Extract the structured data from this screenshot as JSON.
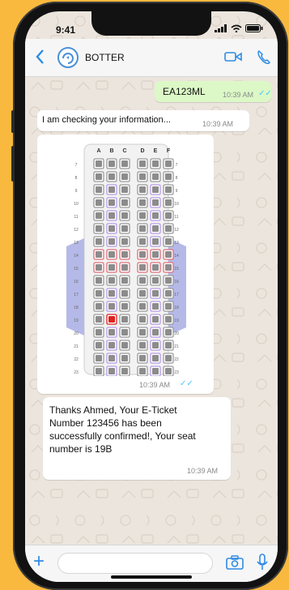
{
  "status": {
    "time": "9:41"
  },
  "header": {
    "contact_name": "BOTTER"
  },
  "messages": {
    "m1": {
      "text": "EA123ML",
      "time": "10:39 AM"
    },
    "m2": {
      "text": "I am checking your information...",
      "time": "10:39 AM"
    },
    "m3": {
      "time": "10:39 AM"
    },
    "m4": {
      "text": "Thanks Ahmed, Your E-Ticket Number 123456 has been successfully confirmed!, Your seat number is 19B",
      "time": "10:39 AM"
    }
  },
  "seatmap": {
    "columns_left": [
      "A",
      "B",
      "C"
    ],
    "columns_right": [
      "D",
      "E",
      "F"
    ],
    "rows": [
      "7",
      "8",
      "9",
      "10",
      "11",
      "12",
      "13",
      "14",
      "15",
      "16",
      "17",
      "18",
      "19",
      "20",
      "21",
      "22",
      "23"
    ],
    "selected_seat": "19B"
  },
  "colors": {
    "outgoing": "#DCF8C6",
    "incoming": "#FFFFFF",
    "accent": "#2E8BE6",
    "ticks": "#4FC3F7",
    "selected": "#E02020",
    "premium": "#B79BE8",
    "exit": "#E0707A"
  }
}
